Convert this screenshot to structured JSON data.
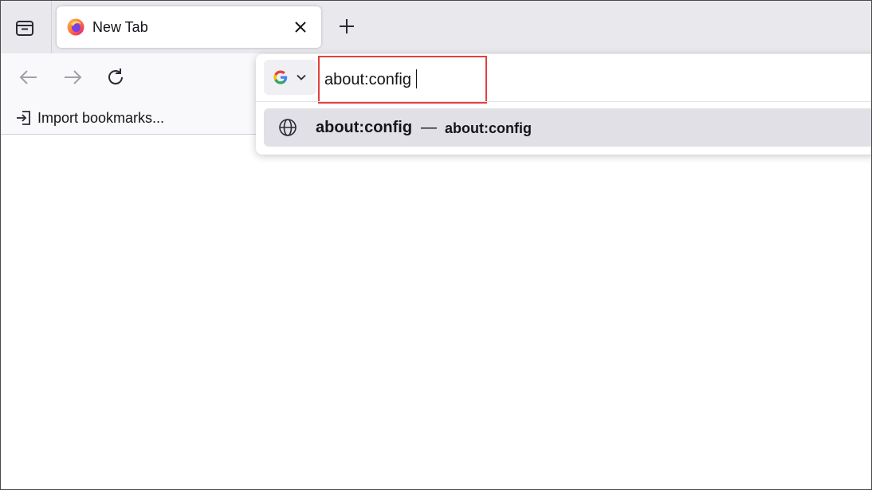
{
  "tabs": [
    {
      "title": "New Tab",
      "favicon": "firefox-icon",
      "active": true
    }
  ],
  "tab_icons": {
    "list": "tab-list-icon",
    "close": "close-icon",
    "new": "plus-icon"
  },
  "nav": {
    "back": "back-arrow-icon",
    "forward": "forward-arrow-icon",
    "reload": "reload-icon"
  },
  "bookmarks": {
    "import_label": "Import bookmarks...",
    "import_icon": "import-icon"
  },
  "urlbar": {
    "value": "about:config",
    "engine_icon": "google-icon",
    "engine_menu_icon": "chevron-down-icon",
    "highlight_color": "#e34040"
  },
  "suggestions": [
    {
      "title": "about:config",
      "separator": "—",
      "url": "about:config",
      "icon": "globe-icon"
    }
  ]
}
